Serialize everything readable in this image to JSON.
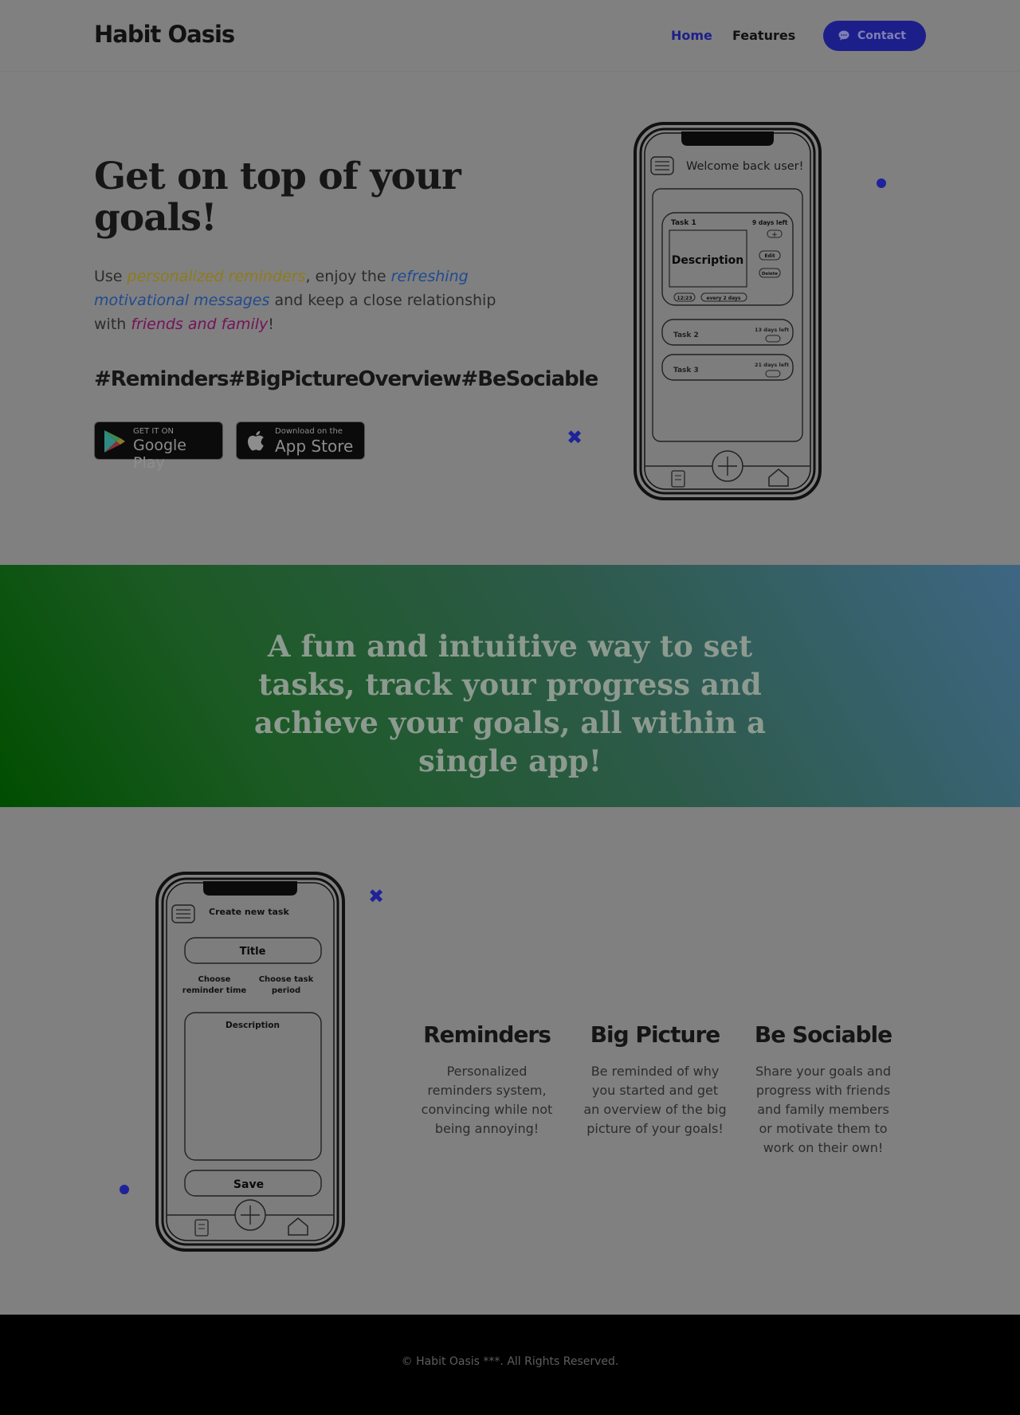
{
  "header": {
    "logo": "Habit Oasis",
    "nav": {
      "home": "Home",
      "features": "Features"
    },
    "contact_label": "Contact"
  },
  "hero": {
    "title": "Get on top of your goals!",
    "text_parts": {
      "p1": "Use ",
      "h1": "personalized reminders",
      "p2": ", enjoy the ",
      "h2": "refreshing motivational messages",
      "p3": " and keep a close relationship with ",
      "h3": "friends and family",
      "p4": "!"
    },
    "hashtags": "#Reminders#BigPictureOverview#BeSociable",
    "google_play": {
      "small": "GET IT ON",
      "big": "Google Play"
    },
    "app_store": {
      "small": "Download on the",
      "big": "App Store"
    }
  },
  "phone_home": {
    "welcome": "Welcome back user!",
    "task1": {
      "title": "Task 1",
      "days": "9 days left",
      "description": "Description",
      "edit": "Edit",
      "delete": "Delete",
      "time": "12:23",
      "period": "every 2 days"
    },
    "task2": {
      "title": "Task 2",
      "days": "13 days left"
    },
    "task3": {
      "title": "Task 3",
      "days": "21 days left"
    }
  },
  "banner": {
    "text": "A fun and intuitive way to set tasks, track your progress and achieve your goals, all within a single app!"
  },
  "phone_create": {
    "heading": "Create new task",
    "title_field": "Title",
    "reminder_time": "Choose reminder time",
    "task_period": "Choose task period",
    "description": "Description",
    "save": "Save"
  },
  "features": [
    {
      "title": "Reminders",
      "text": "Personalized reminders system, convincing while not being annoying!"
    },
    {
      "title": "Big Picture",
      "text": "Be reminded of why you started and get an overview of the big picture of your goals!"
    },
    {
      "title": "Be Sociable",
      "text": "Share your goals and progress with friends and family members or motivate them to work on their own!"
    }
  ],
  "footer": {
    "text": "© Habit Oasis ***. All Rights Reserved."
  },
  "colors": {
    "accent": "#1c1f8a",
    "banner_start": "#004e00",
    "banner_end": "#3e6683",
    "footer": "#000000"
  }
}
